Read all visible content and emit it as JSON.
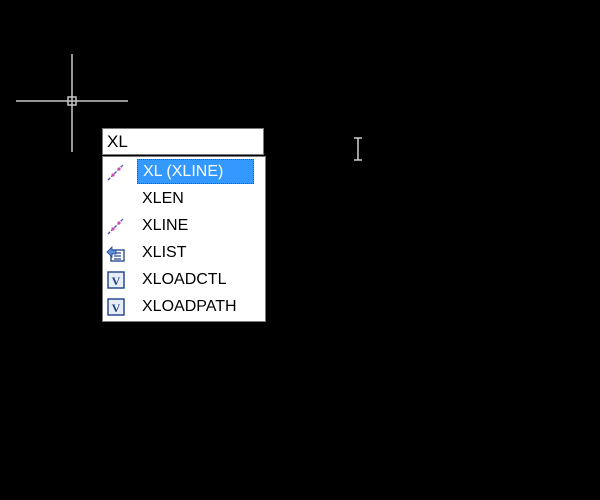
{
  "command_line": {
    "input_value": "XL"
  },
  "autocomplete": {
    "items": [
      {
        "label": "XL (XLINE)",
        "icon": "xline-icon",
        "selected": true
      },
      {
        "label": "XLEN",
        "icon": "",
        "selected": false
      },
      {
        "label": "XLINE",
        "icon": "xline-icon",
        "selected": false
      },
      {
        "label": "XLIST",
        "icon": "xlist-icon",
        "selected": false
      },
      {
        "label": "XLOADCTL",
        "icon": "system-variable-icon",
        "selected": false
      },
      {
        "label": "XLOADPATH",
        "icon": "system-variable-icon",
        "selected": false
      }
    ]
  },
  "colors": {
    "background": "#000000",
    "selection": "#3399ff",
    "crosshair": "#c8c8c8"
  }
}
